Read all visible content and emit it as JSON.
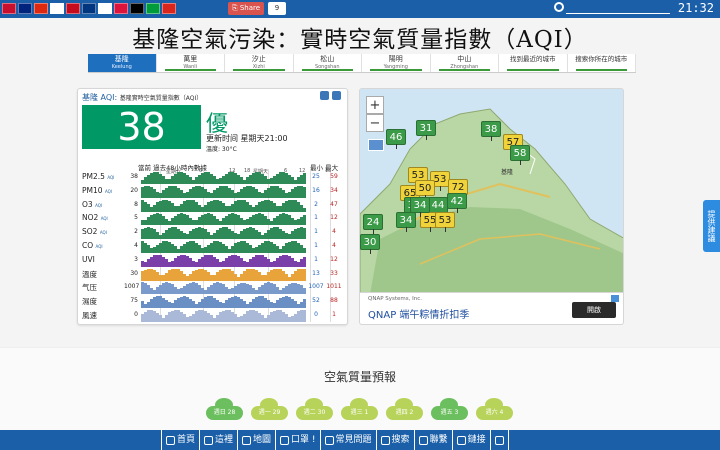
{
  "topbar": {
    "share_label": "Share",
    "share_count": "9",
    "clock": "21:32",
    "flags": [
      "#c8102e",
      "#00247d",
      "#de2910",
      "#fff",
      "#c60b1e",
      "#003580",
      "#fff",
      "#dc143c",
      "#000",
      "#009c3b",
      "#da251d"
    ]
  },
  "title": "基隆空氣污染：實時空氣質量指數（AQI）",
  "tabs": [
    {
      "zh": "基隆",
      "en": "Keelung",
      "active": true
    },
    {
      "zh": "萬里",
      "en": "Wanli",
      "active": false
    },
    {
      "zh": "汐止",
      "en": "Xizhi",
      "active": false
    },
    {
      "zh": "松山",
      "en": "Songshan",
      "active": false
    },
    {
      "zh": "陽明",
      "en": "Yangming",
      "active": false
    },
    {
      "zh": "中山",
      "en": "Zhongshan",
      "active": false
    },
    {
      "zh": "找到最近的城市",
      "en": "",
      "active": false
    },
    {
      "zh": "搜索你所在的城市",
      "en": "",
      "active": false
    }
  ],
  "panel": {
    "head_title": "基隆 AQI:",
    "head_sub": "基隆實時空氣質量指數（AQI）",
    "aqi_value": "38",
    "aqi_level": "優",
    "updated": "更新时间 星期天21:00",
    "temp": "溫度: 30°C",
    "history_label": "當前 過去48小時內數據",
    "minmax_label": "最小 最大",
    "week_labels": [
      "星期六",
      "星期天"
    ],
    "tick_labels": [
      "6",
      "12",
      "18",
      "6",
      "12",
      "18"
    ],
    "rows": [
      {
        "label": "PM2.5",
        "unit": "AQI",
        "cur": "38",
        "min": "25",
        "max": "59",
        "color": "#2e8b57"
      },
      {
        "label": "PM10",
        "unit": "AQI",
        "cur": "20",
        "min": "16",
        "max": "34",
        "color": "#2e8b57"
      },
      {
        "label": "O3",
        "unit": "AQI",
        "cur": "8",
        "min": "2",
        "max": "47",
        "color": "#2e8b57"
      },
      {
        "label": "NO2",
        "unit": "AQI",
        "cur": "5",
        "min": "1",
        "max": "12",
        "color": "#2e8b57"
      },
      {
        "label": "SO2",
        "unit": "AQI",
        "cur": "2",
        "min": "1",
        "max": "4",
        "color": "#2e8b57"
      },
      {
        "label": "CO",
        "unit": "AQI",
        "cur": "4",
        "min": "1",
        "max": "4",
        "color": "#2e8b57"
      },
      {
        "label": "UVI",
        "unit": "",
        "cur": "3",
        "min": "1",
        "max": "12",
        "color": "#7a3fa8"
      },
      {
        "label": "溫度",
        "unit": "",
        "cur": "30",
        "min": "13",
        "max": "33",
        "color": "#e8a33a"
      },
      {
        "label": "气压",
        "unit": "",
        "cur": "1007",
        "min": "1007",
        "max": "1011",
        "color": "#7a9acb"
      },
      {
        "label": "濕度",
        "unit": "",
        "cur": "75",
        "min": "52",
        "max": "88",
        "color": "#6a8fc5"
      },
      {
        "label": "風速",
        "unit": "",
        "cur": "0",
        "min": "0",
        "max": "1",
        "color": "#aab9d8"
      }
    ]
  },
  "map": {
    "markers": [
      {
        "v": "46",
        "c": "good"
      },
      {
        "v": "31",
        "c": "good"
      },
      {
        "v": "38",
        "c": "good"
      },
      {
        "v": "57",
        "c": "mod"
      },
      {
        "v": "58",
        "c": "good"
      },
      {
        "v": "53",
        "c": "mod"
      },
      {
        "v": "65",
        "c": "mod"
      },
      {
        "v": "53",
        "c": "mod"
      },
      {
        "v": "50",
        "c": "mod"
      },
      {
        "v": "72",
        "c": "mod"
      },
      {
        "v": "34",
        "c": "good"
      },
      {
        "v": "42",
        "c": "good"
      },
      {
        "v": "44",
        "c": "good"
      },
      {
        "v": "34",
        "c": "good"
      },
      {
        "v": "55",
        "c": "mod"
      },
      {
        "v": "53",
        "c": "mod"
      },
      {
        "v": "30",
        "c": "good"
      },
      {
        "v": "24",
        "c": "good"
      },
      {
        "v": "34",
        "c": "good"
      }
    ],
    "place_label": "基隆"
  },
  "ad": {
    "advertiser": "QNAP Systems, Inc.",
    "headline": "QNAP 端午粽情折扣季",
    "button": "開啟"
  },
  "side_tab": "提供建議",
  "forecast": {
    "title": "空氣質量預報",
    "days": [
      {
        "label": "週日 28",
        "tone": "g"
      },
      {
        "label": "週一 29",
        "tone": "y"
      },
      {
        "label": "週二 30",
        "tone": "y"
      },
      {
        "label": "週三 1",
        "tone": "y"
      },
      {
        "label": "週四 2",
        "tone": "y"
      },
      {
        "label": "週五 3",
        "tone": "g"
      },
      {
        "label": "週六 4",
        "tone": "y"
      }
    ]
  },
  "bottomnav": [
    {
      "label": "首頁",
      "icon": "home-icon"
    },
    {
      "label": "這裡",
      "icon": "location-icon"
    },
    {
      "label": "地圖",
      "icon": "globe-icon"
    },
    {
      "label": "口罩 !",
      "icon": "mask-icon"
    },
    {
      "label": "常見問題",
      "icon": "faq-icon"
    },
    {
      "label": "搜索",
      "icon": "search-icon"
    },
    {
      "label": "聯繫",
      "icon": "contact-icon"
    },
    {
      "label": "鏈接",
      "icon": "link-icon"
    },
    {
      "label": "",
      "icon": "gear-icon"
    }
  ]
}
